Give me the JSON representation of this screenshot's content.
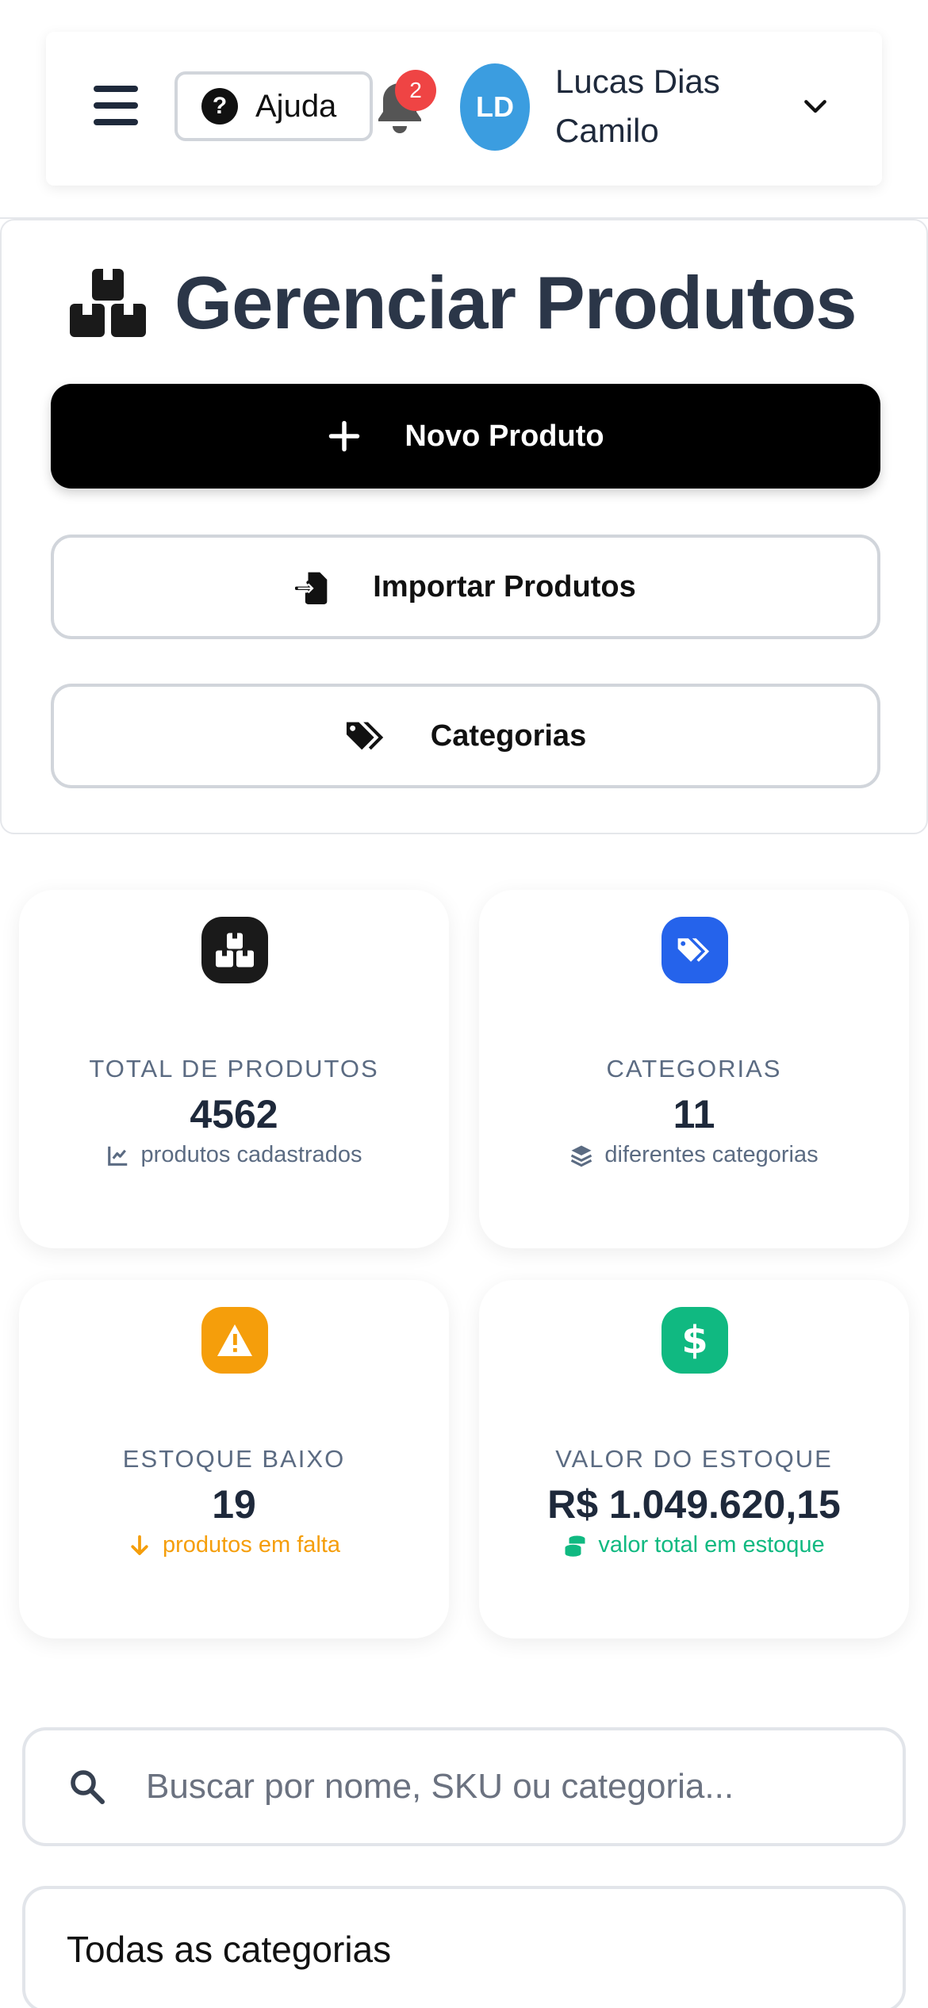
{
  "header": {
    "help_label": "Ajuda",
    "notification_count": "2",
    "avatar_initials": "LD",
    "user_name": "Lucas Dias Camilo"
  },
  "page": {
    "title": "Gerenciar Produtos",
    "actions": {
      "new_product": "Novo Produto",
      "import_products": "Importar Produtos",
      "categories": "Categorias"
    }
  },
  "stats": [
    {
      "label": "TOTAL DE PRODUTOS",
      "value": "4562",
      "sub": "produtos cadastrados",
      "icon": "boxes-icon",
      "color": "#1a1a1a",
      "sub_color": "#5b6b82"
    },
    {
      "label": "CATEGORIAS",
      "value": "11",
      "sub": "diferentes categorias",
      "icon": "tags-icon",
      "color": "#2563eb",
      "sub_color": "#5b6b82"
    },
    {
      "label": "ESTOQUE BAIXO",
      "value": "19",
      "sub": "produtos em falta",
      "icon": "warning-icon",
      "color": "#f59e0b",
      "sub_color": "#f59e0b"
    },
    {
      "label": "VALOR DO ESTOQUE",
      "value": "R$ 1.049.620,15",
      "sub": "valor total em estoque",
      "icon": "dollar-icon",
      "color": "#10b981",
      "sub_color": "#10b981"
    }
  ],
  "filters": {
    "search_placeholder": "Buscar por nome, SKU ou categoria...",
    "search_value": "",
    "category_selected": "Todas as categorias"
  }
}
